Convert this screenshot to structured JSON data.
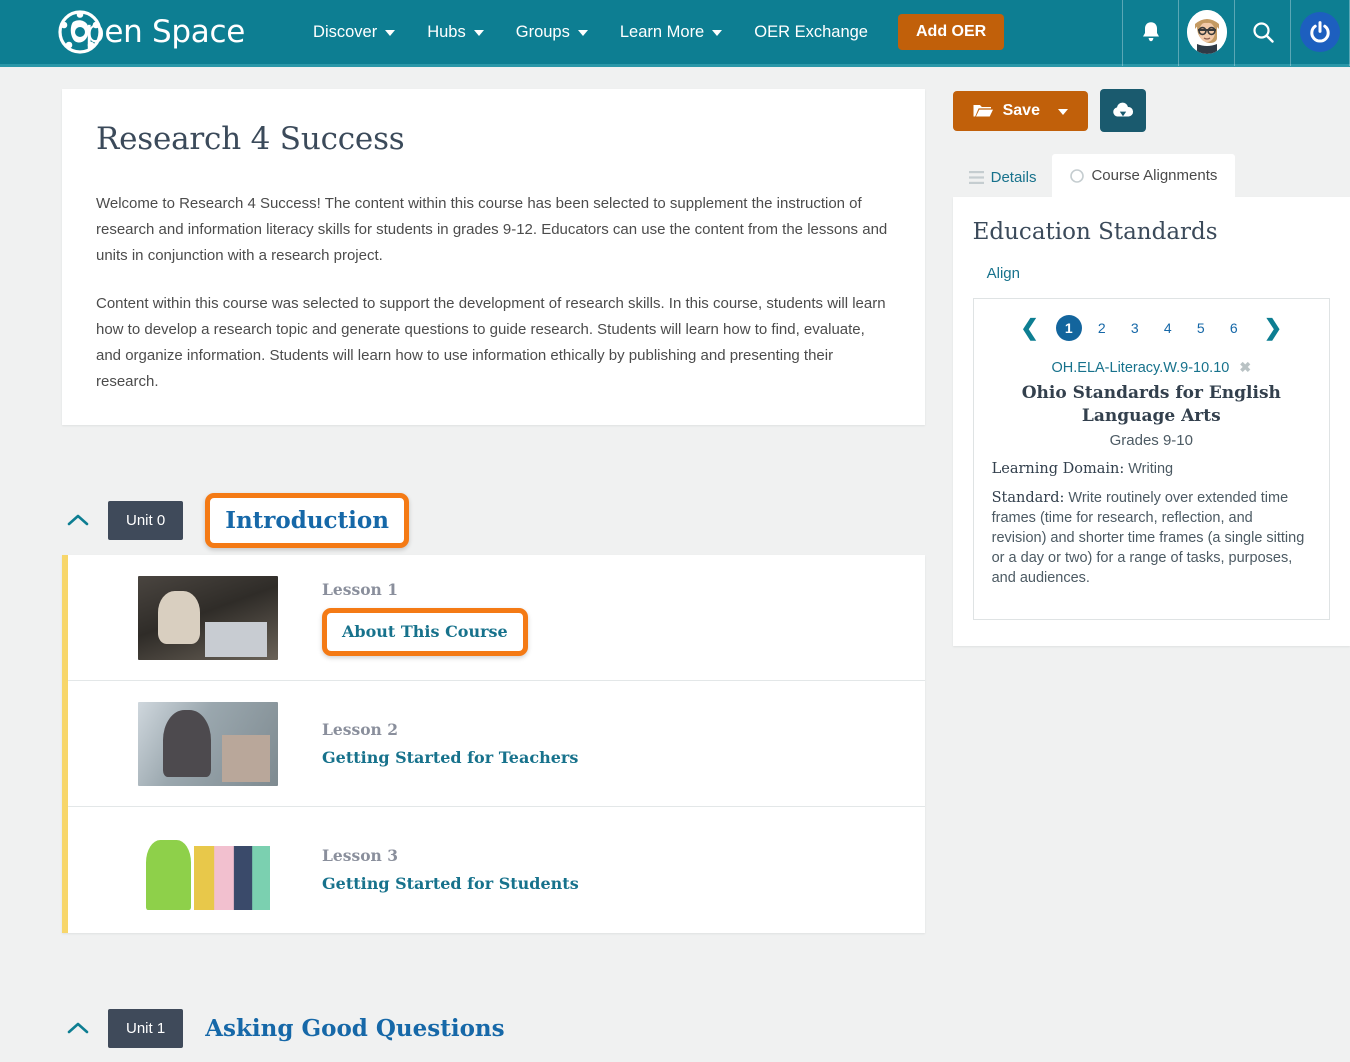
{
  "header": {
    "brand": "pen Space",
    "brand_full": "Open Space",
    "nav": [
      {
        "label": "Discover",
        "has_caret": true
      },
      {
        "label": "Hubs",
        "has_caret": true
      },
      {
        "label": "Groups",
        "has_caret": true
      },
      {
        "label": "Learn More",
        "has_caret": true
      },
      {
        "label": "OER Exchange",
        "has_caret": false
      }
    ],
    "add_oer_label": "Add OER",
    "icons": [
      "bell-icon",
      "avatar",
      "search-icon",
      "power-icon"
    ],
    "bg_color": "#0d7e92",
    "accent_orange": "#c1600a"
  },
  "course": {
    "title": "Research 4 Success",
    "paragraphs": [
      "Welcome to Research 4 Success! The content within this course has been selected to supplement the instruction of research and information literacy skills for students in grades 9-12. Educators can use the content from the lessons and units in conjunction with a research project.",
      "Content within this course was selected to support the development of research skills. In this course, students will learn how to develop a research topic and generate questions to guide research. Students will learn how to find, evaluate, and organize information. Students will learn how to use information ethically by publishing and presenting their research."
    ]
  },
  "units": [
    {
      "badge": "Unit 0",
      "name": "Introduction",
      "highlighted": true,
      "lessons": [
        {
          "num": "Lesson 1",
          "name": "About This Course",
          "highlighted": true,
          "thumb": "teacher-celebrating-thumbnail"
        },
        {
          "num": "Lesson 2",
          "name": "Getting Started for Teachers",
          "highlighted": false,
          "thumb": "teacher-classroom-thumbnail"
        },
        {
          "num": "Lesson 3",
          "name": "Getting Started for Students",
          "highlighted": false,
          "thumb": "students-group-thumbnail"
        }
      ]
    },
    {
      "badge": "Unit 1",
      "name": "Asking Good Questions",
      "highlighted": false,
      "lessons": []
    }
  ],
  "sidebar": {
    "save_label": "Save",
    "download_icon": "cloud-download-icon",
    "tabs": [
      {
        "label": "Details",
        "icon": "list-icon",
        "active": false
      },
      {
        "label": "Course Alignments",
        "icon": "circle-icon",
        "active": true
      }
    ],
    "panel_title": "Education Standards",
    "align_link": "Align",
    "pagination": {
      "pages": [
        "1",
        "2",
        "3",
        "4",
        "5",
        "6"
      ],
      "current": "1",
      "prev_icon": "chevron-left-icon",
      "next_icon": "chevron-right-icon"
    },
    "standard": {
      "code": "OH.ELA-Literacy.W.9-10.10",
      "remove_icon": "close-icon",
      "name": "Ohio Standards for English Language Arts",
      "grades": "Grades 9-10",
      "domain_label": "Learning Domain:",
      "domain_value": " Writing",
      "standard_label": "Standard:",
      "standard_value": " Write routinely over extended time frames (time for research, reflection, and revision) and shorter time frames (a single sitting or a day or two) for a range of tasks, purposes, and audiences."
    }
  },
  "colors": {
    "page_bg": "#f0f1f1",
    "teal": "#0d7e92",
    "orange_highlight": "#f47a15",
    "yellow_rail": "#f7d66a",
    "link_blue": "#1668a8",
    "unit_badge": "#3f4a5a"
  }
}
